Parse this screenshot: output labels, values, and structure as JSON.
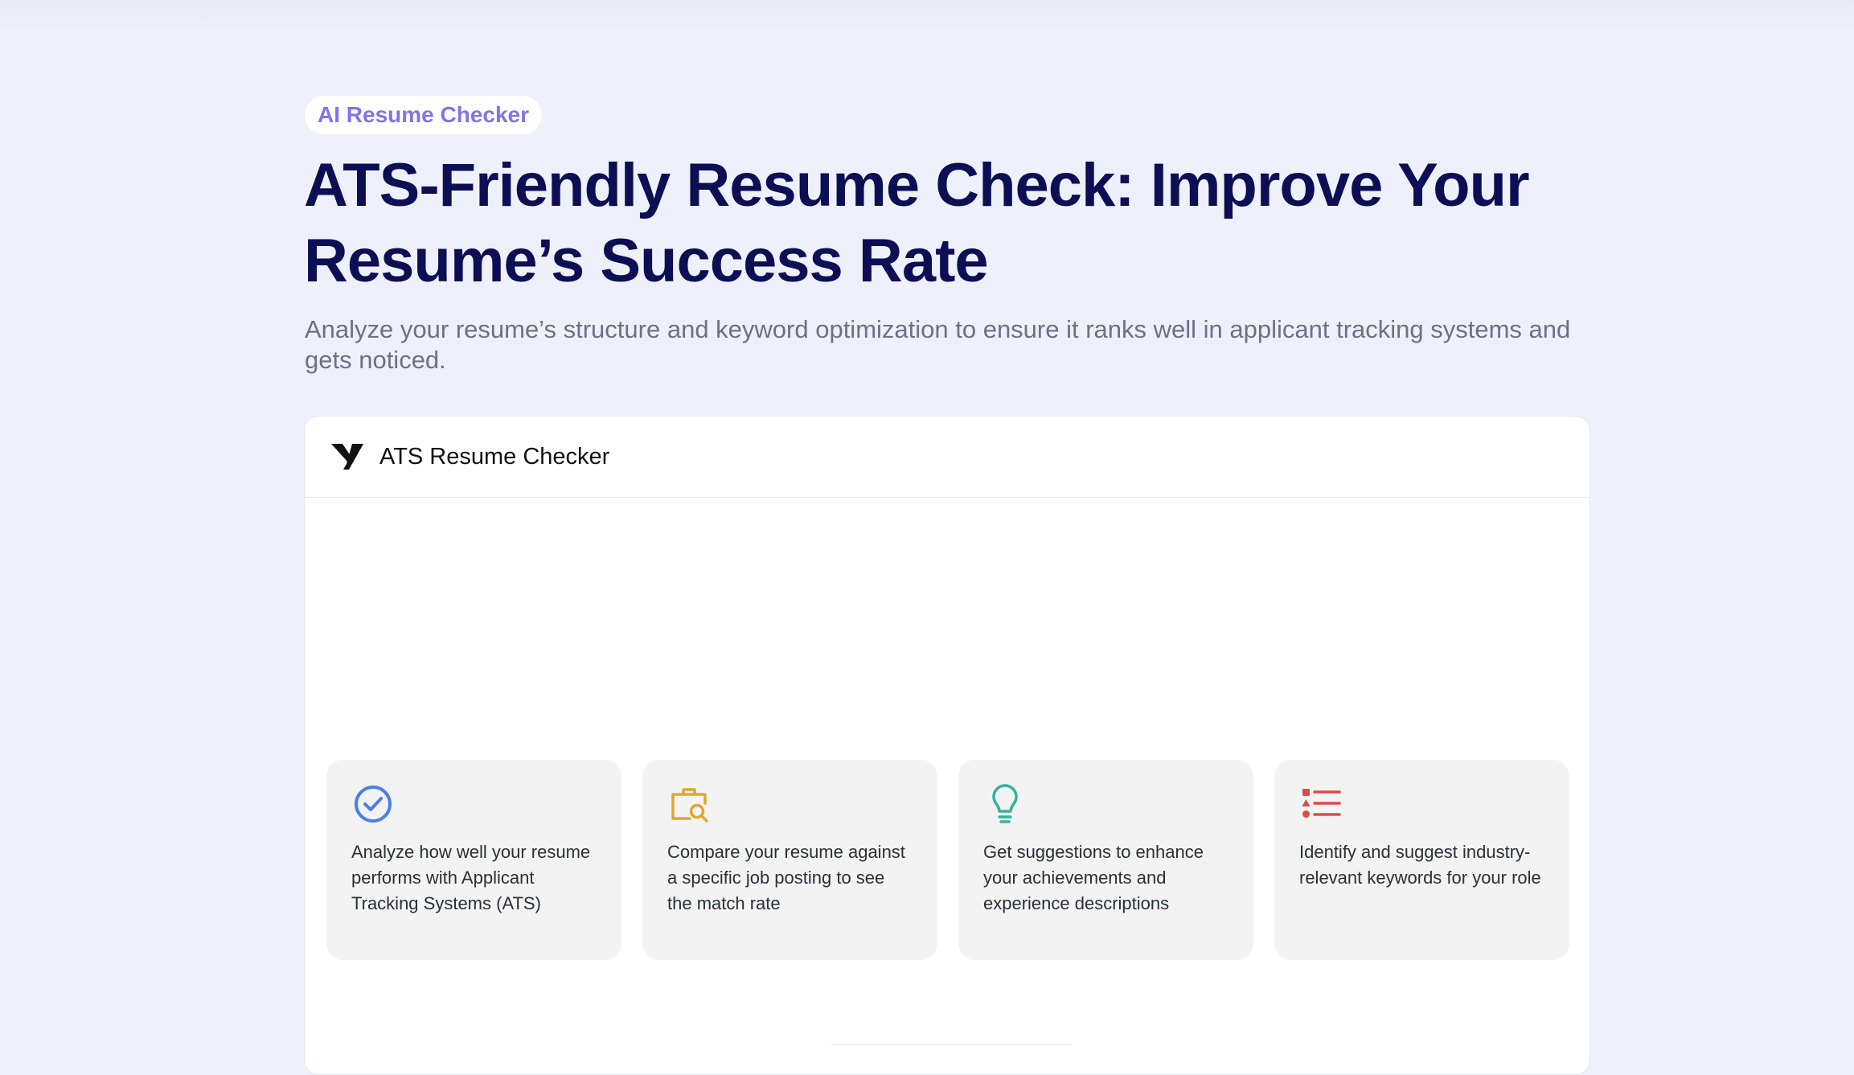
{
  "badge": "AI Resume Checker",
  "headline": "ATS-Friendly Resume Check: Improve Your Resume’s Success Rate",
  "subtitle": "Analyze your resume’s structure and keyword optimization to ensure it ranks well in applicant tracking systems and gets noticed.",
  "tool": {
    "title": "ATS Resume Checker"
  },
  "features": [
    {
      "icon": "check-circle-icon",
      "color": "#4a80e6",
      "text": "Analyze how well your resume performs with Applicant Tracking Systems (ATS)"
    },
    {
      "icon": "briefcase-search-icon",
      "color": "#e0a72f",
      "text": "Compare your resume against a specific job posting to see the match rate"
    },
    {
      "icon": "lightbulb-icon",
      "color": "#36b39c",
      "text": "Get suggestions to enhance your achievements and experience descriptions"
    },
    {
      "icon": "list-icon",
      "color": "#e04a4a",
      "text": "Identify and suggest industry-relevant keywords for your role"
    }
  ],
  "colors": {
    "page_background": "#eef1fb",
    "headline": "#0d0f54",
    "badge_text": "#7f74ea"
  }
}
